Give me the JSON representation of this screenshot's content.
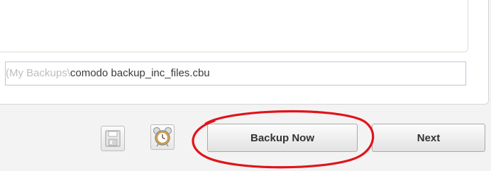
{
  "backup_destination": {
    "path_prefix": "(My Backups\\",
    "path_main": "comodo backup_inc_files.cbu"
  },
  "toolbar": {
    "save_icon": "save-disk-icon",
    "schedule_icon": "alarm-clock-icon",
    "backup_now_label": "Backup Now",
    "next_label": "Next"
  },
  "annotation": {
    "highlight_color": "#e0141c"
  }
}
